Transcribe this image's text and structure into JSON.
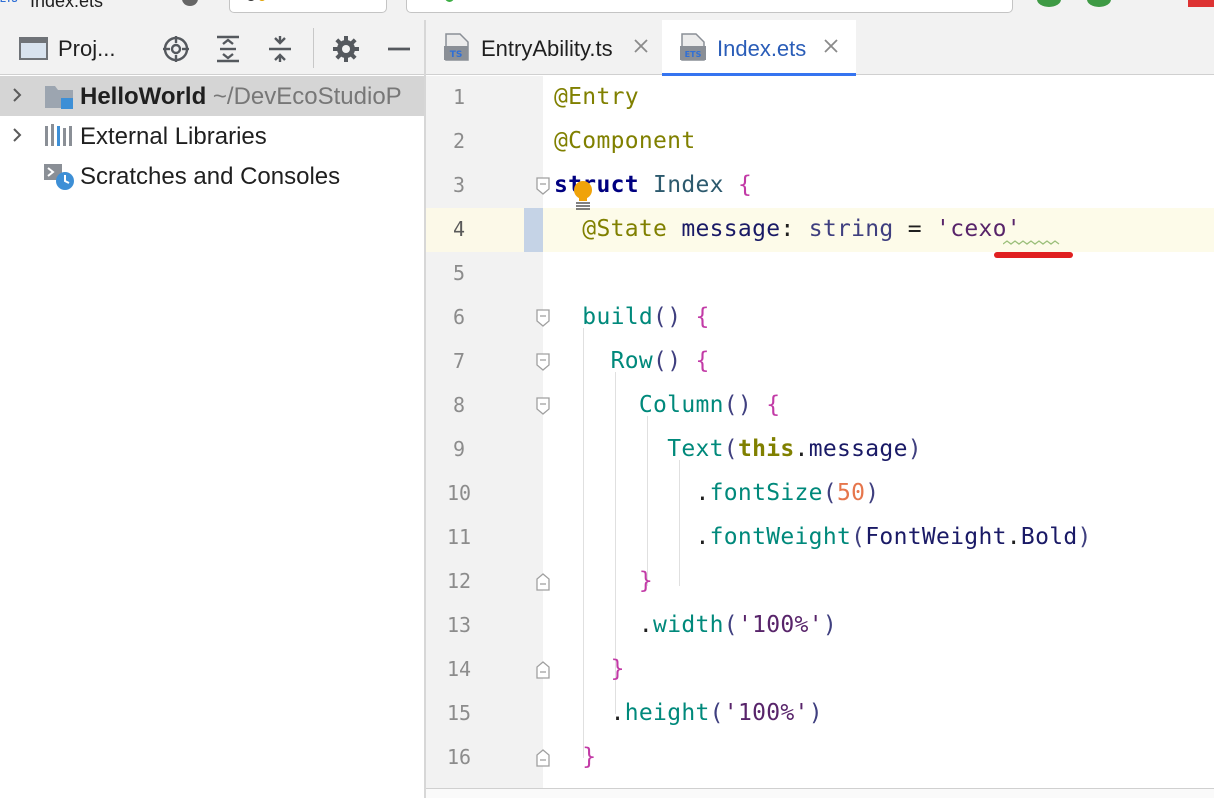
{
  "toolbar": {
    "file_label": "Index.ets"
  },
  "project_panel": {
    "title": "Proj...",
    "tree": [
      {
        "label": "HelloWorld",
        "path": "~/DevEcoStudioP",
        "expanded": false,
        "selected": true,
        "icon": "module-folder-icon"
      },
      {
        "label": "External Libraries",
        "expanded": false,
        "selected": false,
        "icon": "library-icon"
      },
      {
        "label": "Scratches and Consoles",
        "selected": false,
        "icon": "scratches-icon"
      }
    ]
  },
  "editor": {
    "tabs": [
      {
        "label": "EntryAbility.ts",
        "badge": "TS",
        "active": false
      },
      {
        "label": "Index.ets",
        "badge": "ETS",
        "active": true
      }
    ],
    "current_line": 4,
    "lines": [
      {
        "no": "1",
        "text": "@Entry"
      },
      {
        "no": "2",
        "text": "@Component"
      },
      {
        "no": "3",
        "text": "struct Index {"
      },
      {
        "no": "4",
        "text": "  @State message: string = 'cexo'"
      },
      {
        "no": "5",
        "text": ""
      },
      {
        "no": "6",
        "text": "  build() {"
      },
      {
        "no": "7",
        "text": "    Row() {"
      },
      {
        "no": "8",
        "text": "      Column() {"
      },
      {
        "no": "9",
        "text": "        Text(this.message)"
      },
      {
        "no": "10",
        "text": "          .fontSize(50)"
      },
      {
        "no": "11",
        "text": "          .fontWeight(FontWeight.Bold)"
      },
      {
        "no": "12",
        "text": "      }"
      },
      {
        "no": "13",
        "text": "      .width('100%')"
      },
      {
        "no": "14",
        "text": "    }"
      },
      {
        "no": "15",
        "text": "    .height('100%')"
      },
      {
        "no": "16",
        "text": "  }"
      }
    ]
  },
  "colors": {
    "accent": "#3574f0",
    "selection": "#d5d5d5",
    "current_line": "#fdfbe9",
    "error_underline": "#e02020"
  }
}
